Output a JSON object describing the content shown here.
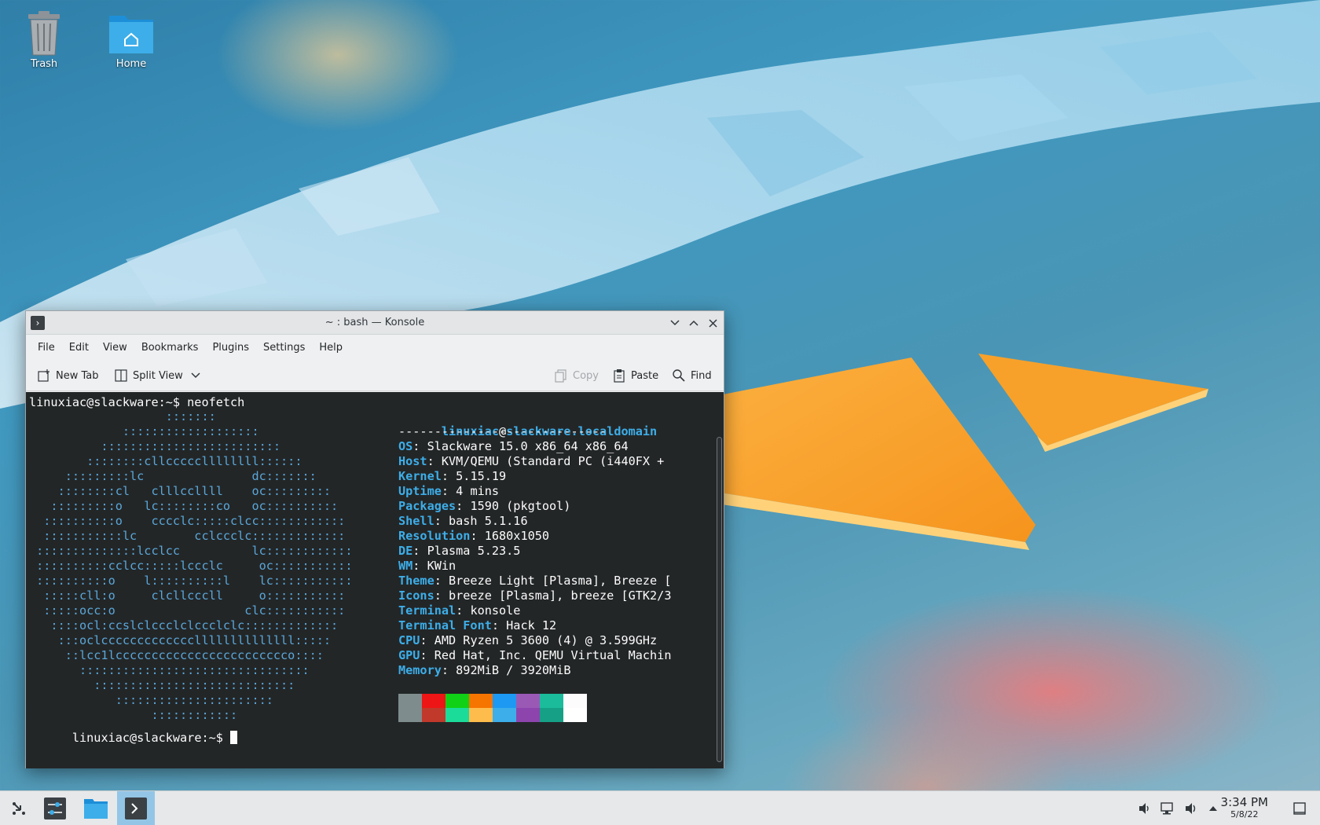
{
  "desktop": {
    "icons": [
      {
        "label": "Trash"
      },
      {
        "label": "Home"
      }
    ]
  },
  "konsole": {
    "title": "~ : bash — Konsole",
    "menu": [
      "File",
      "Edit",
      "View",
      "Bookmarks",
      "Plugins",
      "Settings",
      "Help"
    ],
    "toolbar": {
      "new_tab": "New Tab",
      "split_view": "Split View",
      "copy": "Copy",
      "paste": "Paste",
      "find": "Find"
    },
    "terminal": {
      "prompt_command": "linuxiac@slackware:~$ neofetch",
      "final_prompt": "linuxiac@slackware:~$ ",
      "user": "linuxiac",
      "at": "@",
      "host": "slackware.localdomain",
      "separator": "-----------------------------",
      "info": [
        {
          "key": "OS",
          "value": ": Slackware 15.0 x86_64 x86_64"
        },
        {
          "key": "Host",
          "value": ": KVM/QEMU (Standard PC (i440FX +"
        },
        {
          "key": "Kernel",
          "value": ": 5.15.19"
        },
        {
          "key": "Uptime",
          "value": ": 4 mins"
        },
        {
          "key": "Packages",
          "value": ": 1590 (pkgtool)"
        },
        {
          "key": "Shell",
          "value": ": bash 5.1.16"
        },
        {
          "key": "Resolution",
          "value": ": 1680x1050"
        },
        {
          "key": "DE",
          "value": ": Plasma 5.23.5"
        },
        {
          "key": "WM",
          "value": ": KWin"
        },
        {
          "key": "Theme",
          "value": ": Breeze Light [Plasma], Breeze ["
        },
        {
          "key": "Icons",
          "value": ": breeze [Plasma], breeze [GTK2/3"
        },
        {
          "key": "Terminal",
          "value": ": konsole"
        },
        {
          "key": "Terminal Font",
          "value": ": Hack 12"
        },
        {
          "key": "CPU",
          "value": ": AMD Ryzen 5 3600 (4) @ 3.599GHz"
        },
        {
          "key": "GPU",
          "value": ": Red Hat, Inc. QEMU Virtual Machin"
        },
        {
          "key": "Memory",
          "value": ": 892MiB / 3920MiB"
        }
      ],
      "ascii": [
        "                   :::::::",
        "             :::::::::::::::::::",
        "          :::::::::::::::::::::::::",
        "        ::::::::cllcccccllllllll::::::",
        "     :::::::::lc               dc:::::::",
        "    ::::::::cl   clllccllll    oc:::::::::",
        "   :::::::::o   lc::::::::co   oc::::::::::",
        "  ::::::::::o    cccclc:::::clcc::::::::::::",
        "  :::::::::::lc        cclccclc:::::::::::::",
        " ::::::::::::::lcclcc          lc::::::::::::",
        " ::::::::::cclcc:::::lccclc     oc:::::::::::",
        " ::::::::::o    l::::::::::l    lc:::::::::::",
        "  :::::cll:o     clcllcccll     o:::::::::::",
        "  :::::occ:o                  clc:::::::::::",
        "   ::::ocl:ccslclccclclccclclc:::::::::::::",
        "    :::oclcccccccccccccllllllllllllll:::::",
        "     ::lcc1lcccccccccccccccccccccccco::::",
        "       ::::::::::::::::::::::::::::::::",
        "         ::::::::::::::::::::::::::::",
        "            ::::::::::::::::::::::",
        "                 ::::::::::::"
      ],
      "palette": [
        "#7f8c8d",
        "#ed1515",
        "#11d116",
        "#f67400",
        "#1d99f3",
        "#9b59b6",
        "#1abc9c",
        "#fcfcfc",
        "#7f8c8d",
        "#c0392b",
        "#1cdc9a",
        "#fdbc4b",
        "#3daee9",
        "#8e44ad",
        "#16a085",
        "#ffffff"
      ]
    }
  },
  "taskbar": {
    "clock_time": "3:34 PM",
    "clock_date": "5/8/22"
  },
  "colors": {
    "accent": "#3daee9",
    "terminal_bg": "#232627",
    "taskbar_bg": "#e6e8ea"
  }
}
